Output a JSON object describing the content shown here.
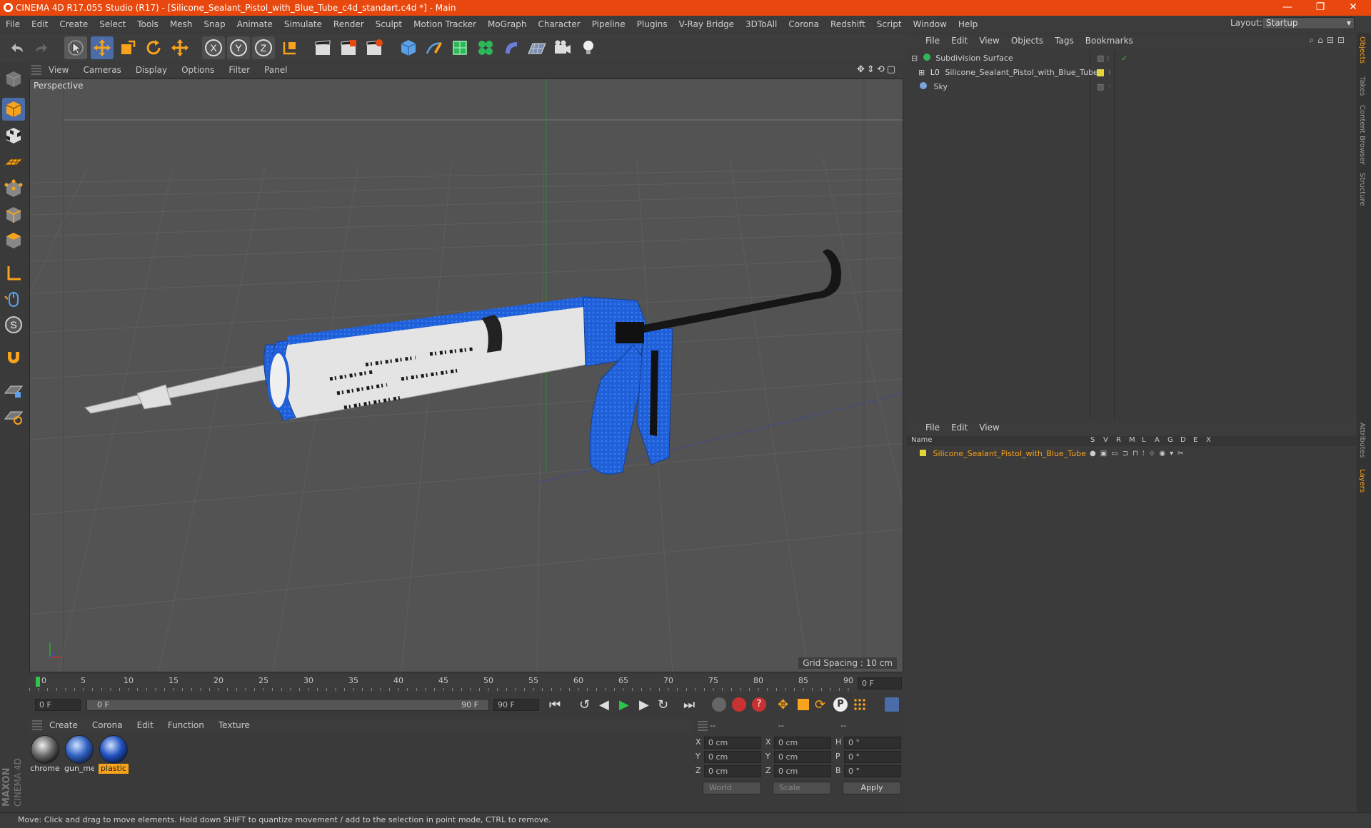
{
  "window": {
    "title": "CINEMA 4D R17.055 Studio (R17) - [Silicone_Sealant_Pistol_with_Blue_Tube_c4d_standart.c4d *] - Main",
    "minimize": "—",
    "maximize": "❐",
    "close": "✕"
  },
  "menu": [
    "File",
    "Edit",
    "Create",
    "Select",
    "Tools",
    "Mesh",
    "Snap",
    "Animate",
    "Simulate",
    "Render",
    "Sculpt",
    "Motion Tracker",
    "MoGraph",
    "Character",
    "Pipeline",
    "Plugins",
    "V-Ray Bridge",
    "3DToAll",
    "Corona",
    "Redshift",
    "Script",
    "Window",
    "Help"
  ],
  "layout": {
    "label": "Layout:",
    "value": "Startup"
  },
  "viewport": {
    "menu": [
      "View",
      "Cameras",
      "Display",
      "Options",
      "Filter",
      "Panel"
    ],
    "label": "Perspective",
    "grid_spacing": "Grid Spacing : 10 cm"
  },
  "timeline": {
    "ticks": [
      "0",
      "5",
      "10",
      "15",
      "20",
      "25",
      "30",
      "35",
      "40",
      "45",
      "50",
      "55",
      "60",
      "65",
      "70",
      "75",
      "80",
      "85",
      "90"
    ],
    "current_frame": "0 F",
    "start_field": "0 F",
    "range_start": "0 F",
    "range_end": "90 F",
    "end_field": "90 F"
  },
  "materials": {
    "menu": [
      "Create",
      "Corona",
      "Edit",
      "Function",
      "Texture"
    ],
    "items": [
      {
        "name": "chrome"
      },
      {
        "name": "gun_me"
      },
      {
        "name": "plastic"
      }
    ]
  },
  "coords": {
    "headers": [
      "--",
      "--",
      "--"
    ],
    "rows": [
      {
        "a": "X",
        "av": "0 cm",
        "b": "X",
        "bv": "0 cm",
        "c": "H",
        "cv": "0 °"
      },
      {
        "a": "Y",
        "av": "0 cm",
        "b": "Y",
        "bv": "0 cm",
        "c": "P",
        "cv": "0 °"
      },
      {
        "a": "Z",
        "av": "0 cm",
        "b": "Z",
        "bv": "0 cm",
        "c": "B",
        "cv": "0 °"
      }
    ],
    "world": "World",
    "scale": "Scale",
    "apply": "Apply"
  },
  "objects": {
    "menu": [
      "File",
      "Edit",
      "View",
      "Objects",
      "Tags",
      "Bookmarks"
    ],
    "items": [
      {
        "name": "Subdivision Surface"
      },
      {
        "name": "Silicone_Sealant_Pistol_with_Blue_Tube"
      },
      {
        "name": "Sky"
      }
    ]
  },
  "layers": {
    "menu": [
      "File",
      "Edit",
      "View"
    ],
    "name_header": "Name",
    "cols": [
      "S",
      "V",
      "R",
      "M",
      "L",
      "A",
      "G",
      "D",
      "E",
      "X"
    ],
    "items": [
      {
        "name": "Silicone_Sealant_Pistol_with_Blue_Tube"
      }
    ]
  },
  "side_tabs": [
    "Objects",
    "Takes",
    "Content Browser",
    "Structure"
  ],
  "side_tabs_bottom": [
    "Attributes",
    "Layers"
  ],
  "brand": {
    "line1": "MAXON",
    "line2": "CINEMA 4D"
  },
  "status": "Move: Click and drag to move elements. Hold down SHIFT to quantize movement / add to the selection in point mode, CTRL to remove.",
  "colors": {
    "title_bar": "#e8480e",
    "accent_orange": "#f7a31c",
    "layer_yellow": "#e3d43a",
    "gun_blue": "#1f5fd8"
  }
}
